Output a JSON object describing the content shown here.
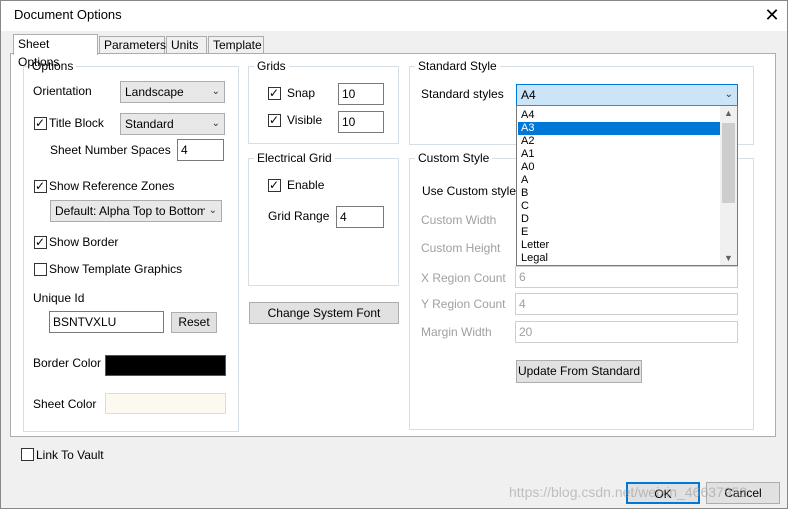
{
  "window": {
    "title": "Document Options",
    "close_glyph": "✕"
  },
  "tabs": [
    {
      "label": "Sheet Options",
      "active": true
    },
    {
      "label": "Parameters"
    },
    {
      "label": "Units"
    },
    {
      "label": "Template"
    }
  ],
  "options": {
    "group_title": "Options",
    "orientation_label": "Orientation",
    "orientation_value": "Landscape",
    "title_block_label": "Title Block",
    "title_block_checked": true,
    "title_block_value": "Standard",
    "sheet_number_spaces_label": "Sheet Number Spaces",
    "sheet_number_spaces_value": "4",
    "show_reference_zones_label": "Show Reference Zones",
    "reference_zones_value": "Default: Alpha Top to Bottom",
    "show_border_label": "Show Border",
    "show_template_graphics_label": "Show Template Graphics",
    "unique_id_label": "Unique Id",
    "unique_id_value": "BSNTVXLU",
    "reset_label": "Reset",
    "border_color_label": "Border Color",
    "border_color": "#000000",
    "sheet_color_label": "Sheet Color",
    "sheet_color": "#fdf8f0"
  },
  "grids": {
    "group_title": "Grids",
    "snap_label": "Snap",
    "snap_value": "10",
    "visible_label": "Visible",
    "visible_value": "10"
  },
  "electrical_grid": {
    "group_title": "Electrical Grid",
    "enable_label": "Enable",
    "grid_range_label": "Grid Range",
    "grid_range_value": "4"
  },
  "change_font_label": "Change System Font",
  "standard_style": {
    "group_title": "Standard Style",
    "standard_styles_label": "Standard styles",
    "selected_value": "A4",
    "dropdown_items": [
      "A4",
      "A3",
      "A2",
      "A1",
      "A0",
      "A",
      "B",
      "C",
      "D",
      "E",
      "Letter",
      "Legal"
    ],
    "highlighted_item": "A3"
  },
  "custom_style": {
    "group_title": "Custom Style",
    "use_custom_label": "Use Custom style",
    "custom_width_label": "Custom Width",
    "custom_height_label": "Custom Height",
    "x_region_label": "X Region Count",
    "x_region_value": "6",
    "y_region_label": "Y Region Count",
    "y_region_value": "4",
    "margin_width_label": "Margin Width",
    "margin_width_value": "20",
    "update_label": "Update From Standard"
  },
  "link_to_vault_label": "Link To Vault",
  "ok_label": "OK",
  "cancel_label": "Cancel",
  "watermark_text": "https://blog.csdn.net/weixin_46637953",
  "colors": {
    "selection": "#0078d7",
    "combo_highlight": "#cce4f7",
    "accent_border": "#0078d7"
  }
}
